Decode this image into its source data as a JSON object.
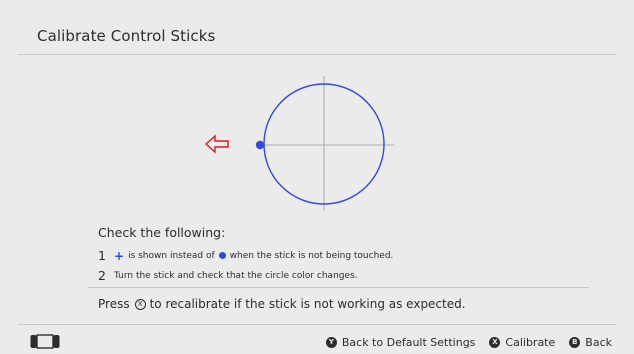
{
  "page": {
    "title": "Calibrate Control Sticks"
  },
  "instructions": {
    "title": "Check the following:",
    "steps": [
      {
        "number": "1",
        "before_icon_text": "",
        "plus_symbol": "+",
        "middle_text": " is shown instead of",
        "after_text": " when the stick is not being touched."
      },
      {
        "number": "2",
        "text": "Turn the stick and check that the circle color changes."
      }
    ],
    "recalibrate_prefix": "Press",
    "recalibrate_button_symbol": "X",
    "recalibrate_suffix": "to recalibrate if the stick is not working as expected."
  },
  "footer": {
    "actions": [
      {
        "button": "Y",
        "label": "Back to Default Settings"
      },
      {
        "button": "X",
        "label": "Calibrate"
      },
      {
        "button": "B",
        "label": "Back"
      }
    ]
  },
  "colors": {
    "accent_blue": "#3348e0",
    "arrow_red": "#e01818",
    "background": "#ebebeb",
    "text": "#2d2d2d",
    "rule": "#c8c8c8"
  },
  "icons": {
    "stick_circle": "stick-circle-icon",
    "left_arrow": "left-arrow-icon",
    "console": "console-icon"
  }
}
